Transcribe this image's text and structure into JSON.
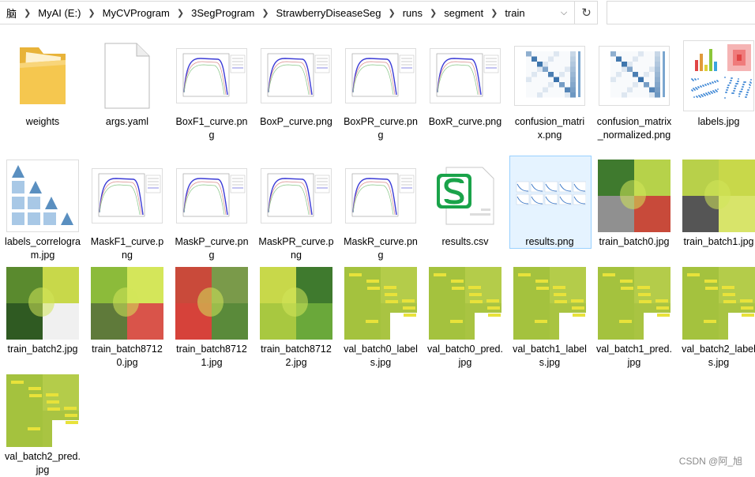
{
  "address": {
    "crumbs": [
      "脑",
      "MyAI (E:)",
      "MyCVProgram",
      "3SegProgram",
      "StrawberryDiseaseSeg",
      "runs",
      "segment",
      "train"
    ]
  },
  "files": [
    {
      "name": "weights",
      "kind": "folder"
    },
    {
      "name": "args.yaml",
      "kind": "doc"
    },
    {
      "name": "BoxF1_curve.png",
      "kind": "curve"
    },
    {
      "name": "BoxP_curve.png",
      "kind": "curve"
    },
    {
      "name": "BoxPR_curve.png",
      "kind": "curve"
    },
    {
      "name": "BoxR_curve.png",
      "kind": "curve"
    },
    {
      "name": "confusion_matrix.png",
      "kind": "matrix"
    },
    {
      "name": "confusion_matrix_normalized.png",
      "kind": "matrix"
    },
    {
      "name": "labels.jpg",
      "kind": "labels"
    },
    {
      "name": "labels_correlogram.jpg",
      "kind": "correlogram"
    },
    {
      "name": "MaskF1_curve.png",
      "kind": "curve"
    },
    {
      "name": "MaskP_curve.png",
      "kind": "curve"
    },
    {
      "name": "MaskPR_curve.png",
      "kind": "curve"
    },
    {
      "name": "MaskR_curve.png",
      "kind": "curve"
    },
    {
      "name": "results.csv",
      "kind": "csv"
    },
    {
      "name": "results.png",
      "kind": "results"
    },
    {
      "name": "train_batch0.jpg",
      "kind": "photo"
    },
    {
      "name": "train_batch1.jpg",
      "kind": "photo"
    },
    {
      "name": "train_batch2.jpg",
      "kind": "photo"
    },
    {
      "name": "train_batch87120.jpg",
      "kind": "photo"
    },
    {
      "name": "train_batch87121.jpg",
      "kind": "photo"
    },
    {
      "name": "train_batch87122.jpg",
      "kind": "photo"
    },
    {
      "name": "val_batch0_labels.jpg",
      "kind": "photo"
    },
    {
      "name": "val_batch0_pred.jpg",
      "kind": "photo"
    },
    {
      "name": "val_batch1_labels.jpg",
      "kind": "photo"
    },
    {
      "name": "val_batch1_pred.jpg",
      "kind": "photo"
    },
    {
      "name": "val_batch2_labels.jpg",
      "kind": "photo"
    },
    {
      "name": "val_batch2_pred.jpg",
      "kind": "photo"
    }
  ],
  "watermark": "CSDN @阿_旭",
  "colors": {
    "selection_bg": "#e5f3ff",
    "selection_border": "#99d1ff",
    "folder": "#f5c74f",
    "csv_green": "#1aa34a"
  }
}
